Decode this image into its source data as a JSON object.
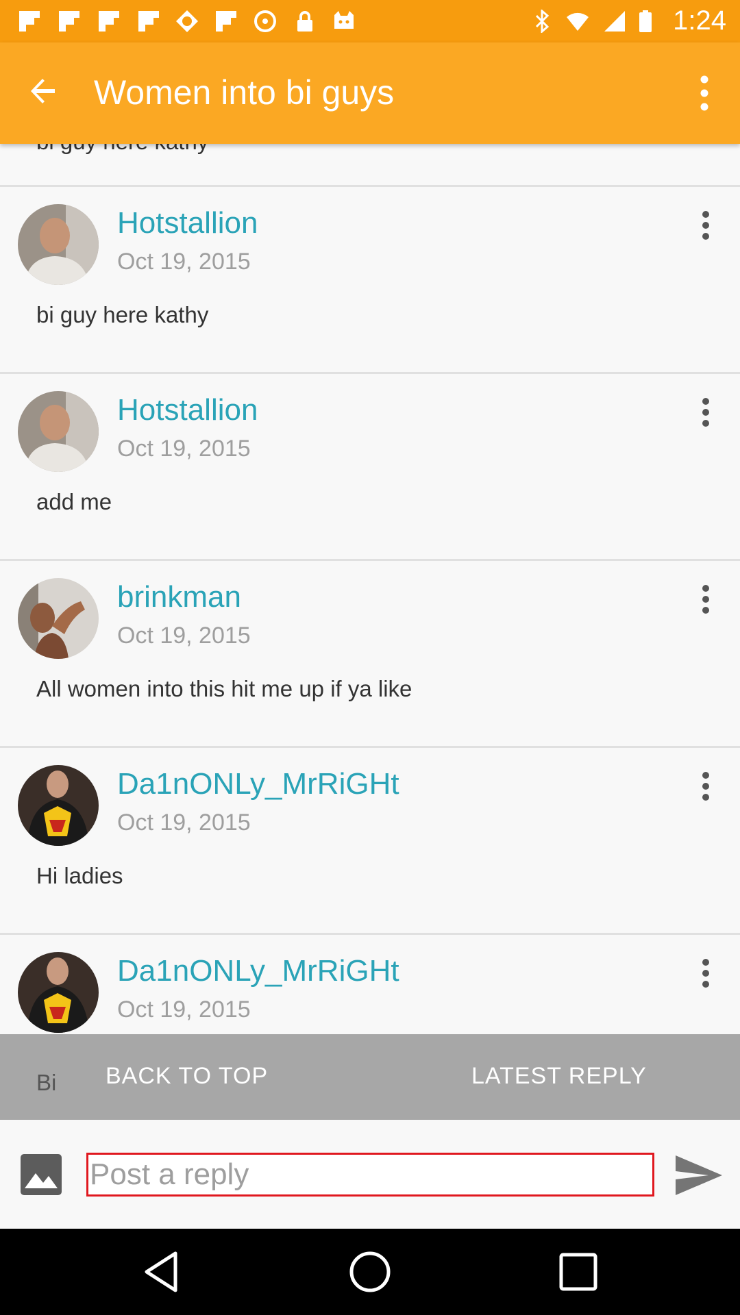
{
  "status_bar": {
    "time": "1:24",
    "icons": [
      "flipboard-icon",
      "flipboard-icon",
      "flipboard-icon",
      "flipboard-icon",
      "app-icon",
      "flipboard-icon",
      "sync-icon",
      "lock-icon",
      "cat-icon",
      "bluetooth-icon",
      "wifi-icon",
      "signal-icon",
      "battery-icon"
    ]
  },
  "app_bar": {
    "title": "Women into bi guys",
    "back_icon": "arrow-left-icon",
    "menu_icon": "more-vert-icon"
  },
  "partial_post": {
    "text": "bi guy here kathy"
  },
  "posts": [
    {
      "username": "Hotstallion",
      "date": "Oct 19, 2015",
      "text": "bi guy here kathy",
      "avatar": "avatar-hotstallion"
    },
    {
      "username": "Hotstallion",
      "date": "Oct 19, 2015",
      "text": "add me",
      "avatar": "avatar-hotstallion"
    },
    {
      "username": "brinkman",
      "date": "Oct 19, 2015",
      "text": "All women into this hit me up if ya like",
      "avatar": "avatar-brinkman"
    },
    {
      "username": "Da1nONLy_MrRiGHt",
      "date": "Oct 19, 2015",
      "text": "Hi ladies",
      "avatar": "avatar-mrright"
    },
    {
      "username": "Da1nONLy_MrRiGHt",
      "date": "Oct 19, 2015",
      "text": "",
      "avatar": "avatar-mrright"
    }
  ],
  "bottom_bar": {
    "partial_text": "Bi",
    "back_to_top": "BACK TO TOP",
    "latest_reply": "LATEST REPLY"
  },
  "reply_bar": {
    "placeholder": "Post a reply",
    "image_icon": "image-icon",
    "send_icon": "send-icon"
  },
  "colors": {
    "status_bar": "#f79c0e",
    "app_bar": "#fba823",
    "username": "#2aa3b7",
    "bottom_bar": "#a7a7a7",
    "input_border": "#e0181f"
  }
}
